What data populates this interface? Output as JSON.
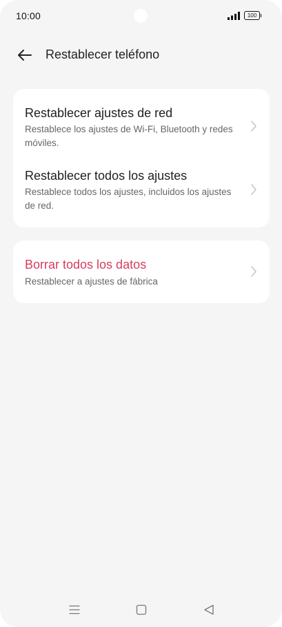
{
  "status_bar": {
    "time": "10:00",
    "battery": "100"
  },
  "header": {
    "title": "Restablecer teléfono"
  },
  "reset_options": [
    {
      "title": "Restablecer ajustes de red",
      "subtitle": "Restablece los ajustes de Wi-Fi, Bluetooth y redes móviles."
    },
    {
      "title": "Restablecer todos los ajustes",
      "subtitle": "Restablece todos los ajustes, incluidos los ajustes de red."
    }
  ],
  "erase": {
    "title": "Borrar todos los datos",
    "subtitle": "Restablecer a ajustes de fábrica",
    "title_color": "#d63d5e"
  },
  "navigation": {
    "icons": [
      "menu-icon",
      "home-icon",
      "back-triangle-icon"
    ]
  }
}
